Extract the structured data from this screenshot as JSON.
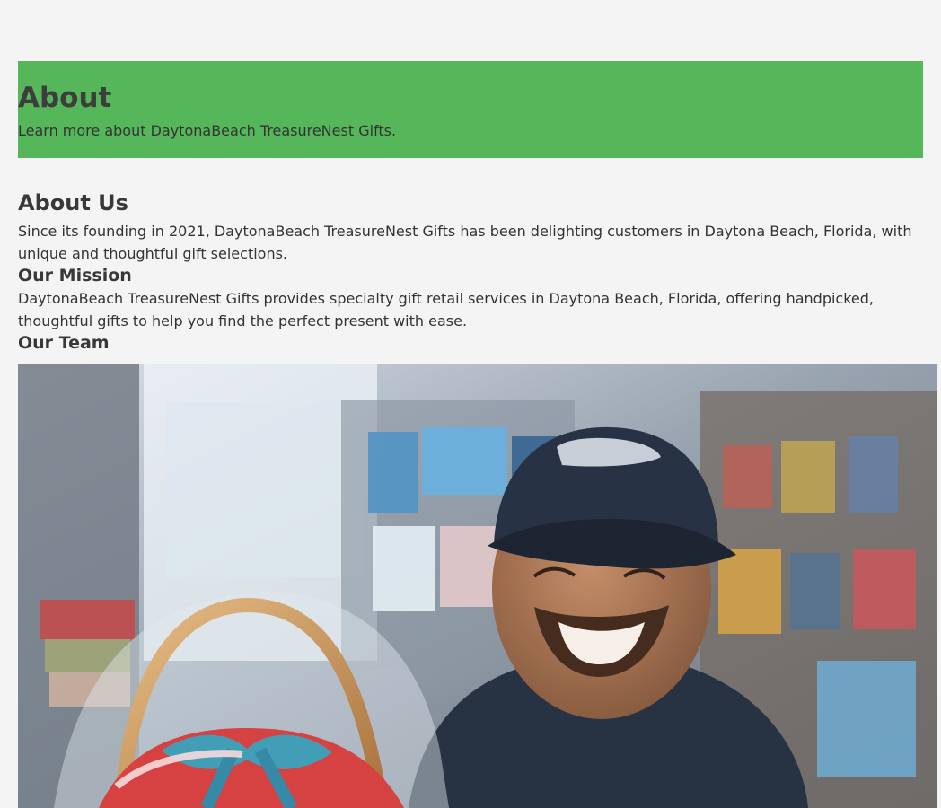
{
  "hero": {
    "title": "About",
    "subtitle": "Learn more about DaytonaBeach TreasureNest Gifts."
  },
  "about_us": {
    "heading": "About Us",
    "text": "Since its founding in 2021, DaytonaBeach TreasureNest Gifts has been delighting customers in Daytona Beach, Florida, with unique and thoughtful gift selections."
  },
  "mission": {
    "heading": "Our Mission",
    "text": "DaytonaBeach TreasureNest Gifts provides specialty gift retail services in Daytona Beach, Florida, offering handpicked, thoughtful gifts to help you find the perfect present with ease."
  },
  "team": {
    "heading": "Our Team"
  },
  "colors": {
    "hero_background": "#55b759",
    "page_background": "#f4f4f4",
    "text": "#333333"
  }
}
